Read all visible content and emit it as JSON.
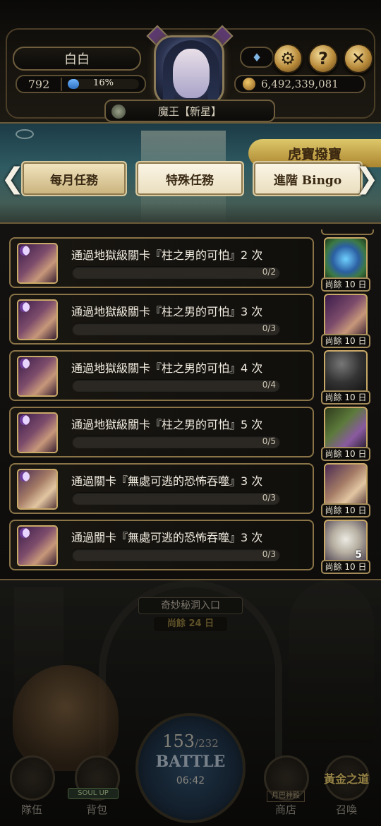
{
  "player": {
    "name": "白白",
    "level": "792",
    "exp_percent": "16%",
    "exp_fraction": 0.16,
    "coins": "6,492,339,081",
    "rank_title": "魔王【新星】"
  },
  "header_buttons": {
    "settings_icon": "gear-icon",
    "help_label": "?",
    "close_label": "✕"
  },
  "banner": {
    "promo_text": "虎寶撥寶"
  },
  "tabs": [
    {
      "label": "每月任務",
      "active": true
    },
    {
      "label": "特殊任務",
      "active": false
    },
    {
      "label": "進階 Bingo",
      "active": false
    }
  ],
  "nav_arrows": {
    "left": "❮",
    "right": "❯"
  },
  "missions": [
    {
      "text": "通過地獄級關卡『柱之男的可怕』2 次",
      "progress": "0/2",
      "reward_days": "尚餘 10 日",
      "reward_count": ""
    },
    {
      "text": "通過地獄級關卡『柱之男的可怕』3 次",
      "progress": "0/3",
      "reward_days": "尚餘 10 日",
      "reward_count": ""
    },
    {
      "text": "通過地獄級關卡『柱之男的可怕』4 次",
      "progress": "0/4",
      "reward_days": "尚餘 10 日",
      "reward_count": ""
    },
    {
      "text": "通過地獄級關卡『柱之男的可怕』5 次",
      "progress": "0/5",
      "reward_days": "尚餘 10 日",
      "reward_count": ""
    },
    {
      "text": "通過關卡『無處可逃的恐怖吞噬』3 次",
      "progress": "0/3",
      "reward_days": "尚餘 10 日",
      "reward_count": ""
    },
    {
      "text": "通過關卡『無處可逃的恐怖吞噬』3 次",
      "progress": "0/3",
      "reward_days": "尚餘 10 日",
      "reward_count": "5"
    }
  ],
  "portal": {
    "name": "奇妙秘洞入口",
    "days_left": "尚餘 24 日"
  },
  "battle": {
    "stamina_current": "153",
    "stamina_max": "/232",
    "label": "BATTLE",
    "timer": "06:42"
  },
  "bottom_nav": {
    "team": "隊伍",
    "bag": "背包",
    "soul_up": "SOUL UP",
    "shop": "商店",
    "shop_sign": "月巴神殿",
    "summon": "召喚",
    "golden_path": "黃金之道"
  }
}
